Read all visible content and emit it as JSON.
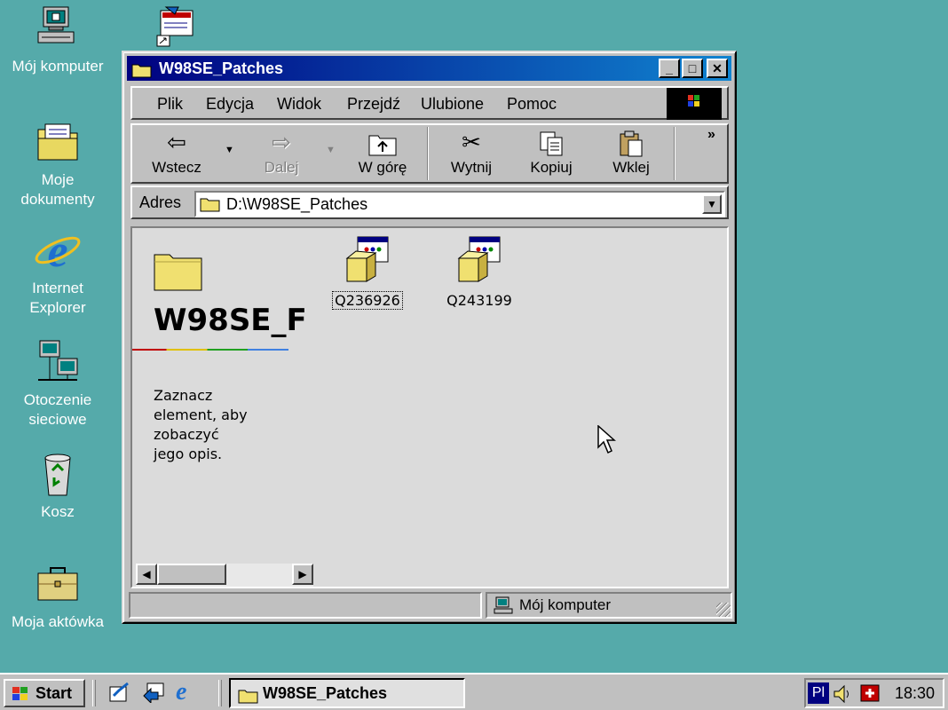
{
  "desktop": {
    "icons": [
      {
        "label": "Mój komputer"
      },
      {
        "label": "Moje dokumenty"
      },
      {
        "label": "Internet Explorer"
      },
      {
        "label": "Otoczenie sieciowe"
      },
      {
        "label": "Kosz"
      },
      {
        "label": "Moja aktówka"
      }
    ]
  },
  "window": {
    "title": "W98SE_Patches",
    "menu": [
      "Plik",
      "Edycja",
      "Widok",
      "Przejdź",
      "Ulubione",
      "Pomoc"
    ],
    "toolbar": {
      "back": "Wstecz",
      "forward": "Dalej",
      "up": "W górę",
      "cut": "Wytnij",
      "copy": "Kopiuj",
      "paste": "Wklej",
      "more": "»"
    },
    "address": {
      "label": "Adres",
      "value": "D:\\W98SE_Patches"
    },
    "content": {
      "folder_heading": "W98SE_F",
      "description": [
        "Zaznacz",
        "element, aby",
        "zobaczyć",
        "jego opis."
      ],
      "files": [
        {
          "name": "Q236926",
          "selected": true
        },
        {
          "name": "Q243199",
          "selected": false
        }
      ]
    },
    "status": {
      "location": "Mój komputer"
    }
  },
  "taskbar": {
    "start": "Start",
    "task": "W98SE_Patches",
    "lang": "Pl",
    "clock": "18:30"
  },
  "colors": {
    "desktop": "#55aaaa",
    "titlebar_start": "#000080",
    "titlebar_end": "#1084d0",
    "window": "#c0c0c0"
  }
}
